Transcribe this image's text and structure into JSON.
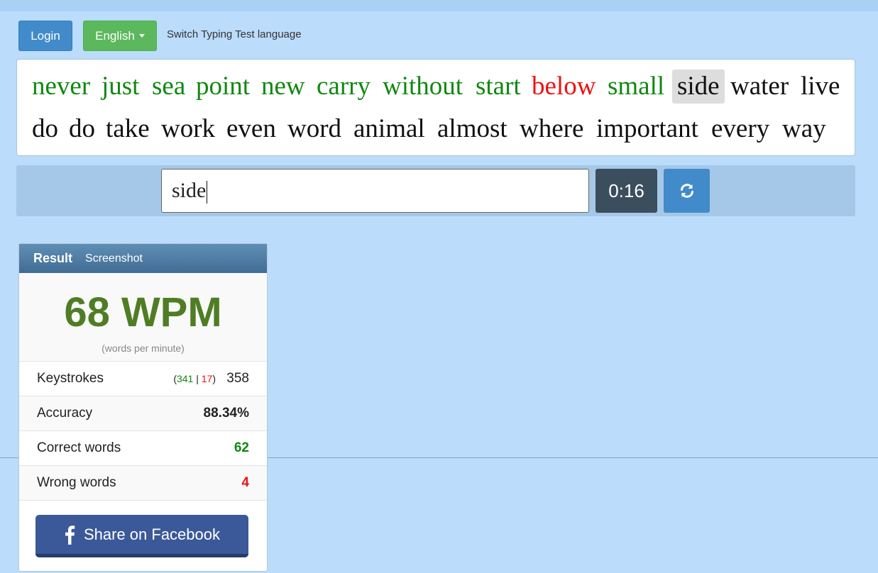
{
  "header": {
    "login_label": "Login",
    "language_label": "English",
    "switch_label": "Switch Typing Test language"
  },
  "words": {
    "row1": [
      {
        "text": "never",
        "state": "correct"
      },
      {
        "text": "just",
        "state": "correct"
      },
      {
        "text": "sea",
        "state": "correct"
      },
      {
        "text": "point",
        "state": "correct"
      },
      {
        "text": "new",
        "state": "correct"
      },
      {
        "text": "carry",
        "state": "correct"
      },
      {
        "text": "without",
        "state": "correct"
      },
      {
        "text": "start",
        "state": "correct"
      },
      {
        "text": "below",
        "state": "wrong"
      },
      {
        "text": "small",
        "state": "correct"
      },
      {
        "text": "side",
        "state": "current"
      },
      {
        "text": "water",
        "state": "pending"
      },
      {
        "text": "live",
        "state": "pending"
      }
    ],
    "row2": [
      {
        "text": "do",
        "state": "pending"
      },
      {
        "text": "do",
        "state": "pending"
      },
      {
        "text": "take",
        "state": "pending"
      },
      {
        "text": "work",
        "state": "pending"
      },
      {
        "text": "even",
        "state": "pending"
      },
      {
        "text": "word",
        "state": "pending"
      },
      {
        "text": "animal",
        "state": "pending"
      },
      {
        "text": "almost",
        "state": "pending"
      },
      {
        "text": "where",
        "state": "pending"
      },
      {
        "text": "important",
        "state": "pending"
      },
      {
        "text": "every",
        "state": "pending"
      },
      {
        "text": "way",
        "state": "pending"
      }
    ]
  },
  "input": {
    "value": "side",
    "timer": "0:16",
    "reload_icon": "refresh-icon"
  },
  "result": {
    "title": "Result",
    "screenshot_tab": "Screenshot",
    "wpm": "68 WPM",
    "wpm_caption": "(words per minute)",
    "keystrokes": {
      "label": "Keystrokes",
      "open": "(",
      "correct": "341",
      "sep": "|",
      "wrong": "17",
      "close": ")",
      "total": "358"
    },
    "accuracy": {
      "label": "Accuracy",
      "value": "88.34%"
    },
    "correct_words": {
      "label": "Correct words",
      "value": "62"
    },
    "wrong_words": {
      "label": "Wrong words",
      "value": "4"
    },
    "share_label": "Share on Facebook",
    "share_icon": "facebook-icon"
  },
  "colors": {
    "correct": "#118811",
    "wrong": "#ee1111",
    "pending": "#111111",
    "page_bg": "#bbdcfb"
  }
}
